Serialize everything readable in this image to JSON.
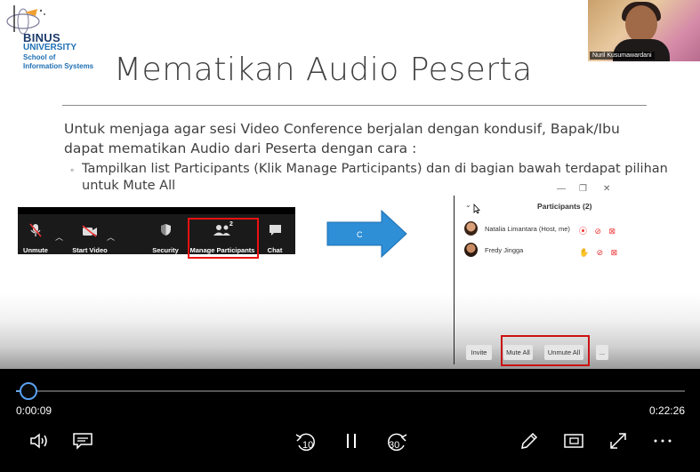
{
  "logo": {
    "brand": "BINUS",
    "university": "UNIVERSITY",
    "school_line1": "School of",
    "school_line2": "Information Systems"
  },
  "slide": {
    "title": "Mematikan Audio Peserta",
    "paragraph_line1": "Untuk menjaga agar sesi Video Conference berjalan dengan kondusif, Bapak/Ibu",
    "paragraph_line2": "dapat mematikan Audio dari Peserta dengan cara :",
    "bullet_marker": "◦",
    "bullet_line1": "Tampilkan list Participants (Klik Manage Participants) dan di bagian bawah terdapat pilihan",
    "bullet_line2": "untuk Mute All"
  },
  "zoom_toolbar": {
    "unmute": "Unmute",
    "start_video": "Start Video",
    "security": "Security",
    "manage_participants": "Manage Participants",
    "participant_count": "2",
    "chat": "Chat"
  },
  "arrow_label": "C",
  "participants_panel": {
    "title": "Participants (2)",
    "participants": [
      {
        "name": "Natalia Limantara (Host, me)"
      },
      {
        "name": "Fredy Jingga"
      }
    ],
    "buttons": {
      "invite": "Invite",
      "mute_all": "Mute All",
      "unmute_all": "Unmute All",
      "more": "..."
    }
  },
  "webcam": {
    "name": "Nuril Kusumawardani"
  },
  "player": {
    "current_time": "0:00:09",
    "total_time": "0:22:26",
    "progress_fraction": 0.0067,
    "skip_back_seconds": "10",
    "skip_forward_seconds": "30",
    "accent_color": "#5aa0f0"
  },
  "icons": {
    "volume": "volume-icon",
    "captions": "captions-icon",
    "skip_back": "skip-back-10-icon",
    "pause": "pause-icon",
    "skip_forward": "skip-forward-30-icon",
    "edit": "pencil-icon",
    "mini_view": "mini-view-icon",
    "fullscreen": "fullscreen-icon",
    "more": "more-icon"
  }
}
